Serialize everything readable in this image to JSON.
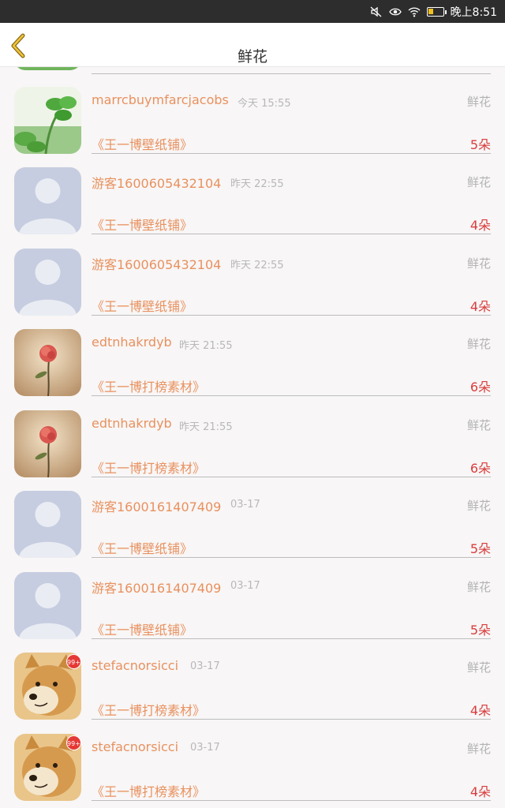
{
  "status_bar": {
    "time": "晚上8:51"
  },
  "header": {
    "title": "鲜花"
  },
  "rows": [
    {
      "avatar": "clover-photo",
      "name": "marrcbuymfarcjacobs",
      "time": "今天 15:55",
      "category": "鲜花",
      "shop": "《王一博壁纸铺》",
      "count": "5朵"
    },
    {
      "avatar": "default-user",
      "name": "游客1600605432104",
      "time": "昨天 22:55",
      "category": "鲜花",
      "shop": "《王一博壁纸铺》",
      "count": "4朵"
    },
    {
      "avatar": "default-user",
      "name": "游客1600605432104",
      "time": "昨天 22:55",
      "category": "鲜花",
      "shop": "《王一博壁纸铺》",
      "count": "4朵"
    },
    {
      "avatar": "rose-photo",
      "name": "edtnhakrdyb",
      "time": "昨天 21:55",
      "category": "鲜花",
      "shop": "《王一博打榜素材》",
      "count": "6朵"
    },
    {
      "avatar": "rose-photo",
      "name": "edtnhakrdyb",
      "time": "昨天 21:55",
      "category": "鲜花",
      "shop": "《王一博打榜素材》",
      "count": "6朵"
    },
    {
      "avatar": "default-user",
      "name": "游客1600161407409",
      "time": "03-17",
      "category": "鲜花",
      "shop": "《王一博壁纸铺》",
      "count": "5朵"
    },
    {
      "avatar": "default-user",
      "name": "游客1600161407409",
      "time": "03-17",
      "category": "鲜花",
      "shop": "《王一博壁纸铺》",
      "count": "5朵"
    },
    {
      "avatar": "shiba-photo",
      "badge": "99+",
      "name": "stefacnorsicci",
      "time": "03-17",
      "category": "鲜花",
      "shop": "《王一博打榜素材》",
      "count": "4朵"
    },
    {
      "avatar": "shiba-photo",
      "badge": "99+",
      "name": "stefacnorsicci",
      "time": "03-17",
      "category": "鲜花",
      "shop": "《王一博打榜素材》",
      "count": "4朵"
    }
  ]
}
